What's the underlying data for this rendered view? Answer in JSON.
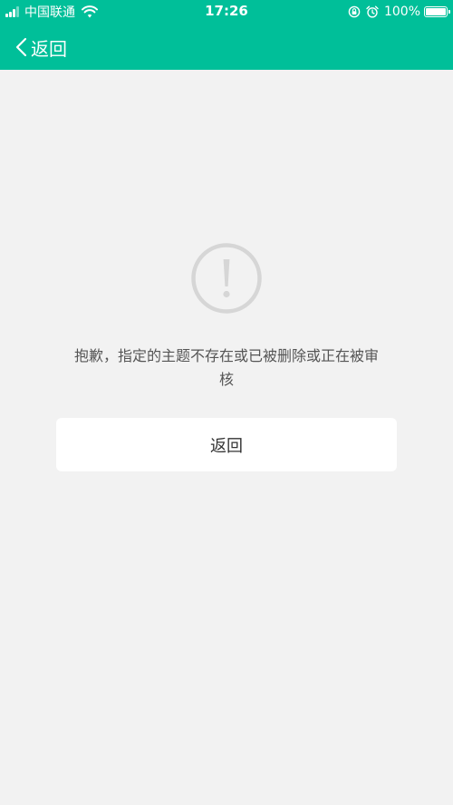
{
  "status_bar": {
    "carrier": "中国联通",
    "time": "17:26",
    "battery": "100%"
  },
  "nav": {
    "back_label": "返回"
  },
  "error": {
    "message": "抱歉，指定的主题不存在或已被删除或正在被审核",
    "button_label": "返回"
  },
  "colors": {
    "accent": "#00bf99",
    "background": "#f2f2f2",
    "icon_gray": "#d6d6d6"
  },
  "icons": {
    "status": [
      "signal-icon",
      "wifi-icon",
      "rotation-lock-icon",
      "alarm-icon",
      "battery-icon"
    ],
    "nav": "chevron-left-icon",
    "main": "exclamation-circle-icon"
  }
}
